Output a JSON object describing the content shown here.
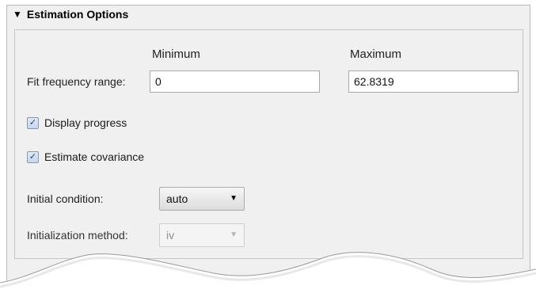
{
  "section": {
    "title": "Estimation Options",
    "collapse_icon": "triangle-down-icon"
  },
  "frequency": {
    "col_minimum": "Minimum",
    "col_maximum": "Maximum",
    "label": "Fit frequency range:",
    "min_value": "0",
    "max_value": "62.8319"
  },
  "options": {
    "display_progress": {
      "label": "Display progress",
      "checked": true
    },
    "estimate_covariance": {
      "label": "Estimate covariance",
      "checked": true
    }
  },
  "initial_condition": {
    "label": "Initial condition:",
    "value": "auto"
  },
  "initialization_method": {
    "label": "Initialization method:",
    "value": "iv",
    "enabled": false
  },
  "colors": {
    "panel_bg": "#f0f0f0",
    "check_mark": "#1d3f88"
  }
}
